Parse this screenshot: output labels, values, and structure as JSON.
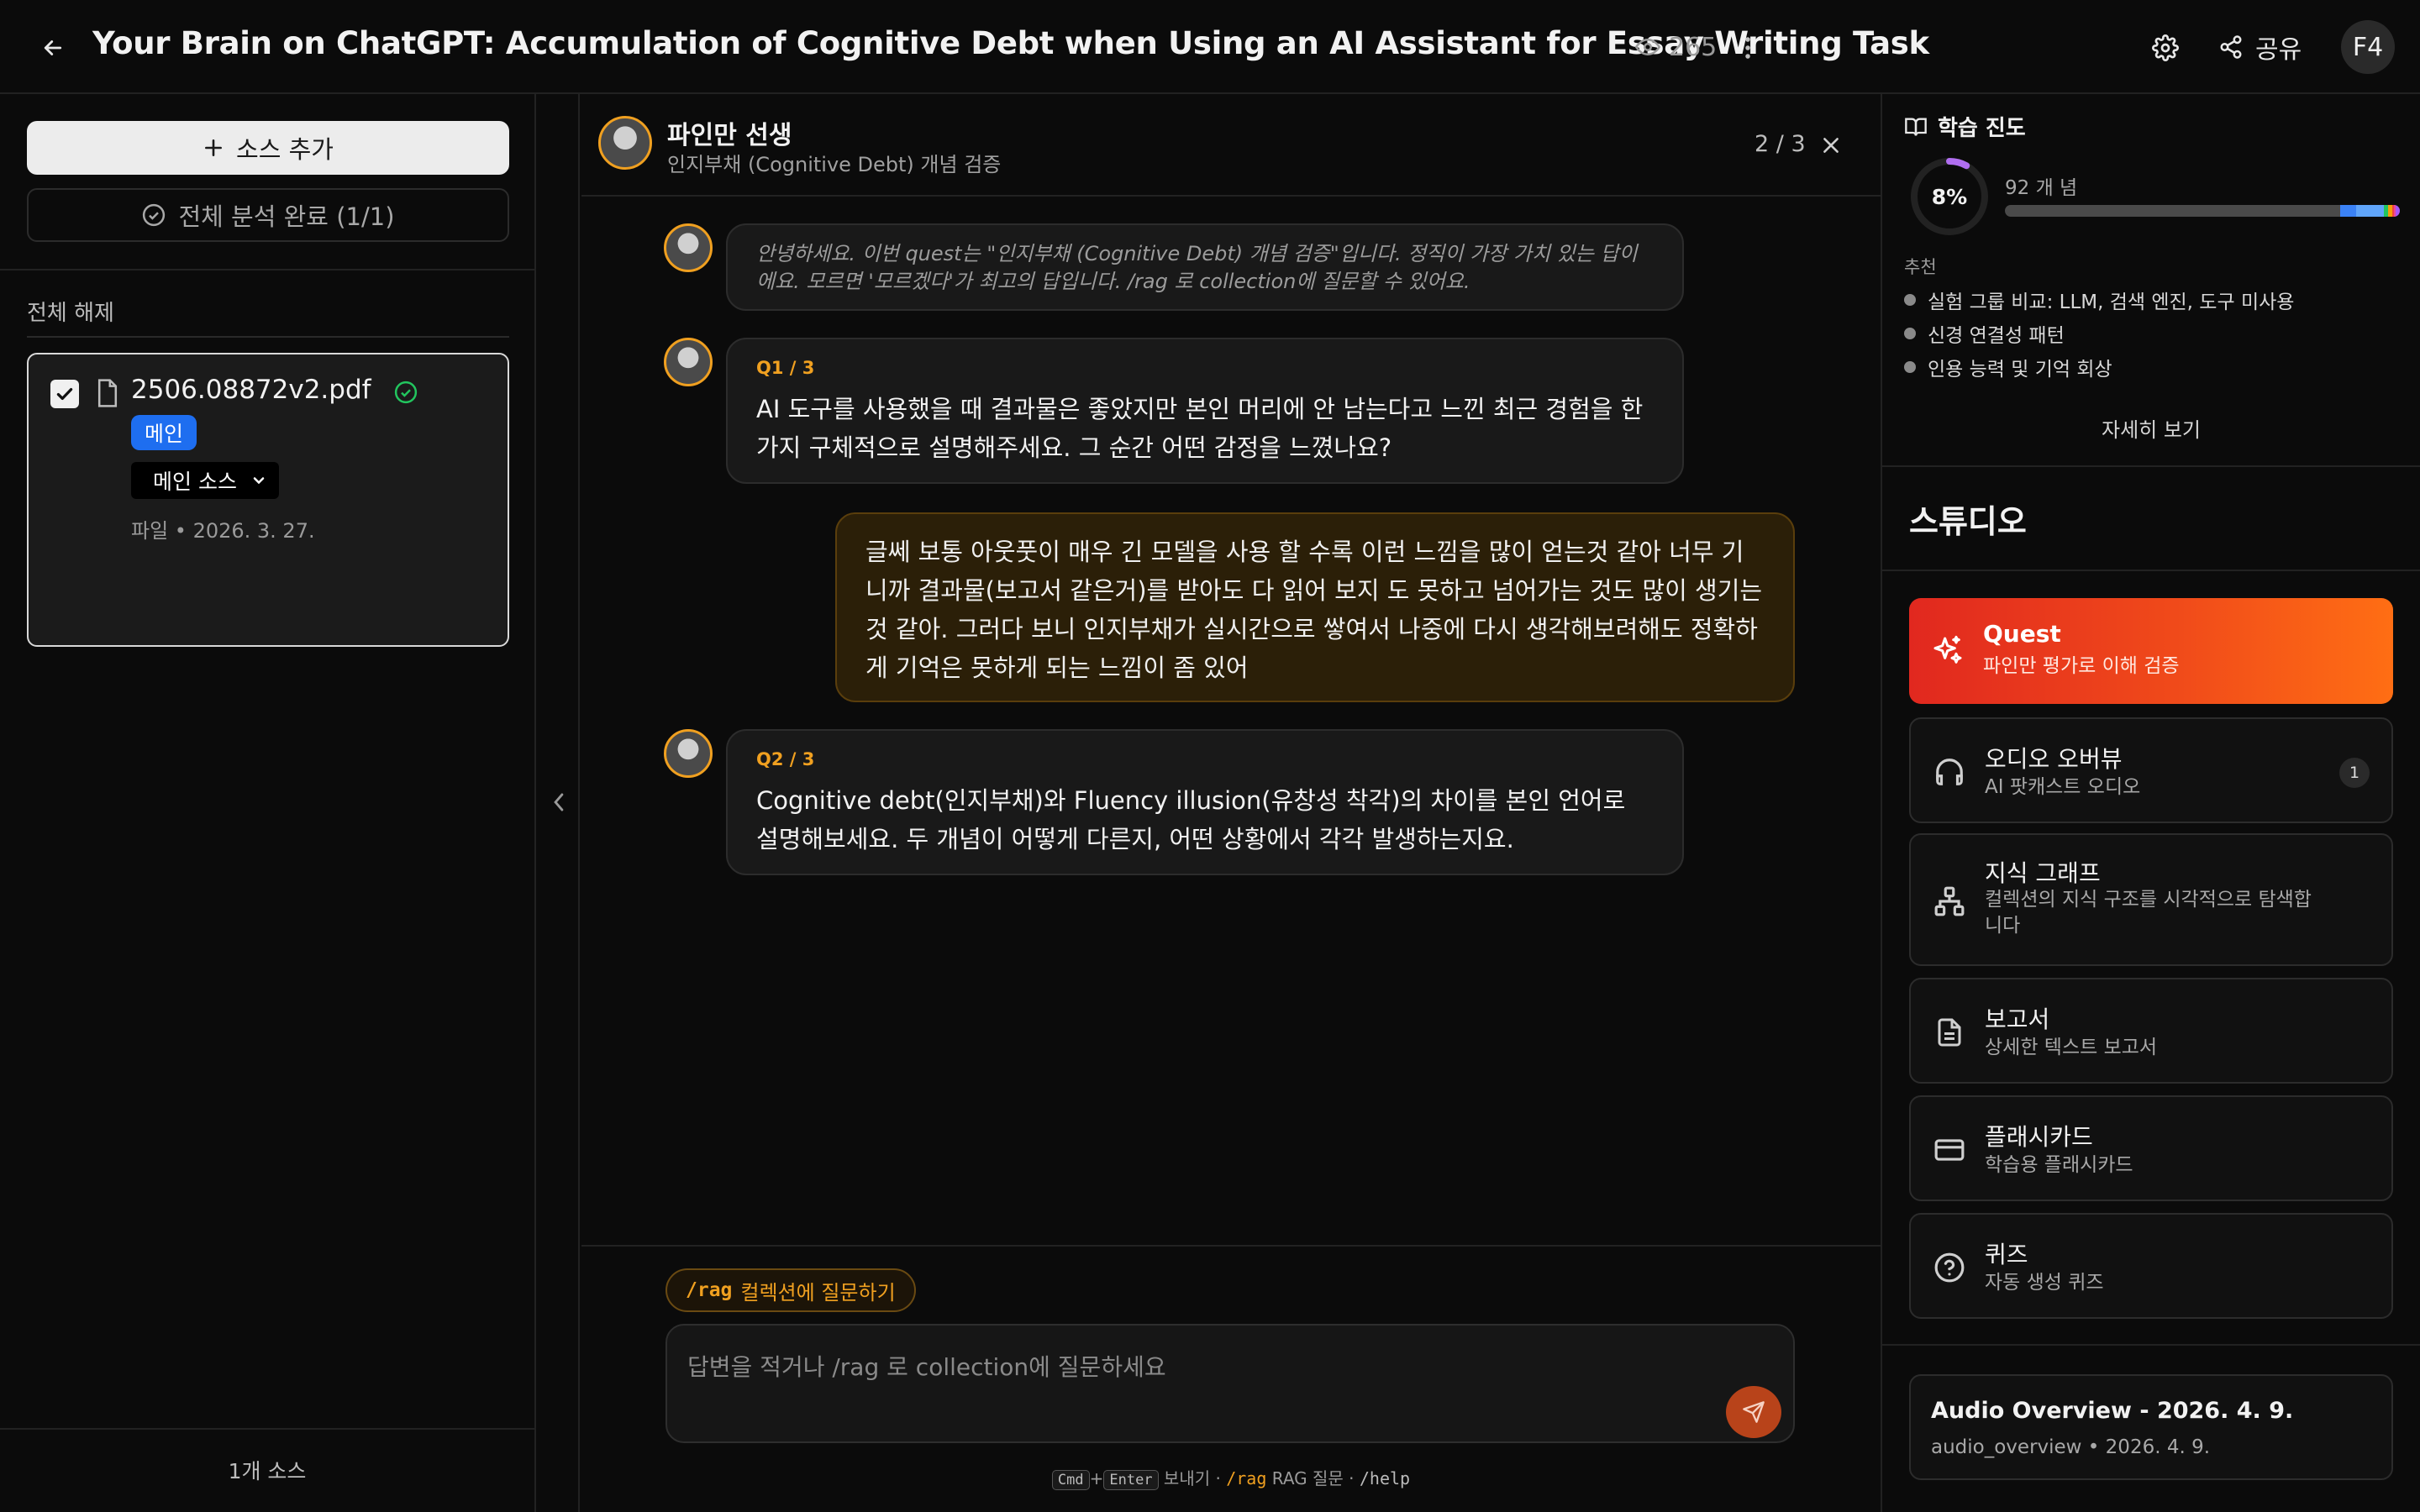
{
  "header": {
    "title": "Your Brain on ChatGPT: Accumulation of Cognitive Debt when Using an AI Assistant for Essay Writing Task",
    "views": "265",
    "share_label": "공유",
    "avatar_initials": "F4"
  },
  "sources": {
    "add_button": "소스 추가",
    "analysis_status": "전체 분석 완료 (1/1)",
    "deselect_all": "전체 해제",
    "items": [
      {
        "name": "2506.08872v2.pdf",
        "badge": "메인",
        "role_select": "메인 소스",
        "meta": "파일 • 2026. 3. 27.",
        "checked": true,
        "status": "done"
      }
    ],
    "count_label": "1개 소스"
  },
  "chat": {
    "persona_name": "파인만 선생",
    "persona_subtitle": "인지부채 (Cognitive Debt) 개념 검증",
    "progress": "2 / 3",
    "messages": [
      {
        "role": "assistant",
        "text": "안녕하세요. 이번 quest는 \"인지부채 (Cognitive Debt) 개념 검증\"입니다. 정직이 가장 가치 있는 답이에요. 모르면 '모르겠다'가 최고의 답입니다. /rag 로 collection에 질문할 수 있어요."
      },
      {
        "role": "assistant",
        "tag": "Q1 / 3",
        "text": "AI 도구를 사용했을 때 결과물은 좋았지만 본인 머리에 안 남는다고 느낀 최근 경험을 한 가지 구체적으로 설명해주세요. 그 순간 어떤 감정을 느꼈나요?"
      },
      {
        "role": "user",
        "text": "글쎄 보통 아웃풋이 매우 긴 모델을 사용 할 수록 이런 느낌을 많이 얻는것 같아 너무 기니까 결과물(보고서 같은거)를 받아도 다 읽어 보지 도 못하고 넘어가는 것도 많이 생기는 것 같아. 그러다 보니 인지부채가 실시간으로 쌓여서 나중에 다시 생각해보려해도 정확하게 기억은 못하게 되는 느낌이 좀 있어"
      },
      {
        "role": "assistant",
        "tag": "Q2 / 3",
        "text": "Cognitive debt(인지부채)와 Fluency illusion(유창성 착각)의 차이를 본인 언어로 설명해보세요. 두 개념이 어떻게 다른지, 어떤 상황에서 각각 발생하는지요."
      }
    ],
    "rag_chip_cmd": "/rag",
    "rag_chip_label": "컬렉션에 질문하기",
    "input_placeholder": "답변을 적거나 /rag 로 collection에 질문하세요",
    "hint": {
      "key1": "Cmd",
      "plus": "+",
      "key2": "Enter",
      "send": " 보내기 · ",
      "rag_cmd": "/rag",
      "rag_text": " RAG 질문 · ",
      "help_cmd": "/help"
    }
  },
  "progress": {
    "title": "학습 진도",
    "percent": 8,
    "percent_label": "8%",
    "concepts": "92 개 념",
    "bar_segments": [
      {
        "color": "#3b82f6",
        "fraction": 0.04
      },
      {
        "color": "#60a5fa",
        "fraction": 0.07
      },
      {
        "color": "#22c55e",
        "fraction": 0.01
      },
      {
        "color": "#f59e0b",
        "fraction": 0.01
      },
      {
        "color": "#ef4444",
        "fraction": 0.005
      },
      {
        "color": "#ec4899",
        "fraction": 0.005
      },
      {
        "color": "#a855f7",
        "fraction": 0.01
      }
    ],
    "recommend_label": "추천",
    "recommendations": [
      "실험 그룹 비교: LLM, 검색 엔진, 도구 미사용",
      "신경 연결성 패턴",
      "인용 능력 및 기억 회상"
    ],
    "more_label": "자세히 보기"
  },
  "studio": {
    "title": "스튜디오",
    "cards": [
      {
        "title": "Quest",
        "subtitle": "파인만 평가로 이해 검증",
        "icon": "sparkles-icon"
      },
      {
        "title": "오디오 오버뷰",
        "subtitle": "AI 팟캐스트 오디오",
        "icon": "headphones-icon",
        "badge": "1"
      },
      {
        "title": "지식 그래프",
        "subtitle": "컬렉션의 지식 구조를 시각적으로 탐색합니다",
        "icon": "hierarchy-icon"
      },
      {
        "title": "보고서",
        "subtitle": "상세한 텍스트 보고서",
        "icon": "document-icon"
      },
      {
        "title": "플래시카드",
        "subtitle": "학습용 플래시카드",
        "icon": "card-icon"
      },
      {
        "title": "퀴즈",
        "subtitle": "자동 생성 퀴즈",
        "icon": "question-circle-icon"
      }
    ],
    "recent": {
      "title": "Audio Overview - 2026. 4. 9.",
      "meta": "audio_overview • 2026. 4. 9."
    }
  },
  "colors": {
    "accent": "#f0a020",
    "quest_gradient_start": "#e1281f",
    "quest_gradient_end": "#ff6e14",
    "badge_blue": "#1e6ef0",
    "ring_purple": "#b06ef0"
  }
}
